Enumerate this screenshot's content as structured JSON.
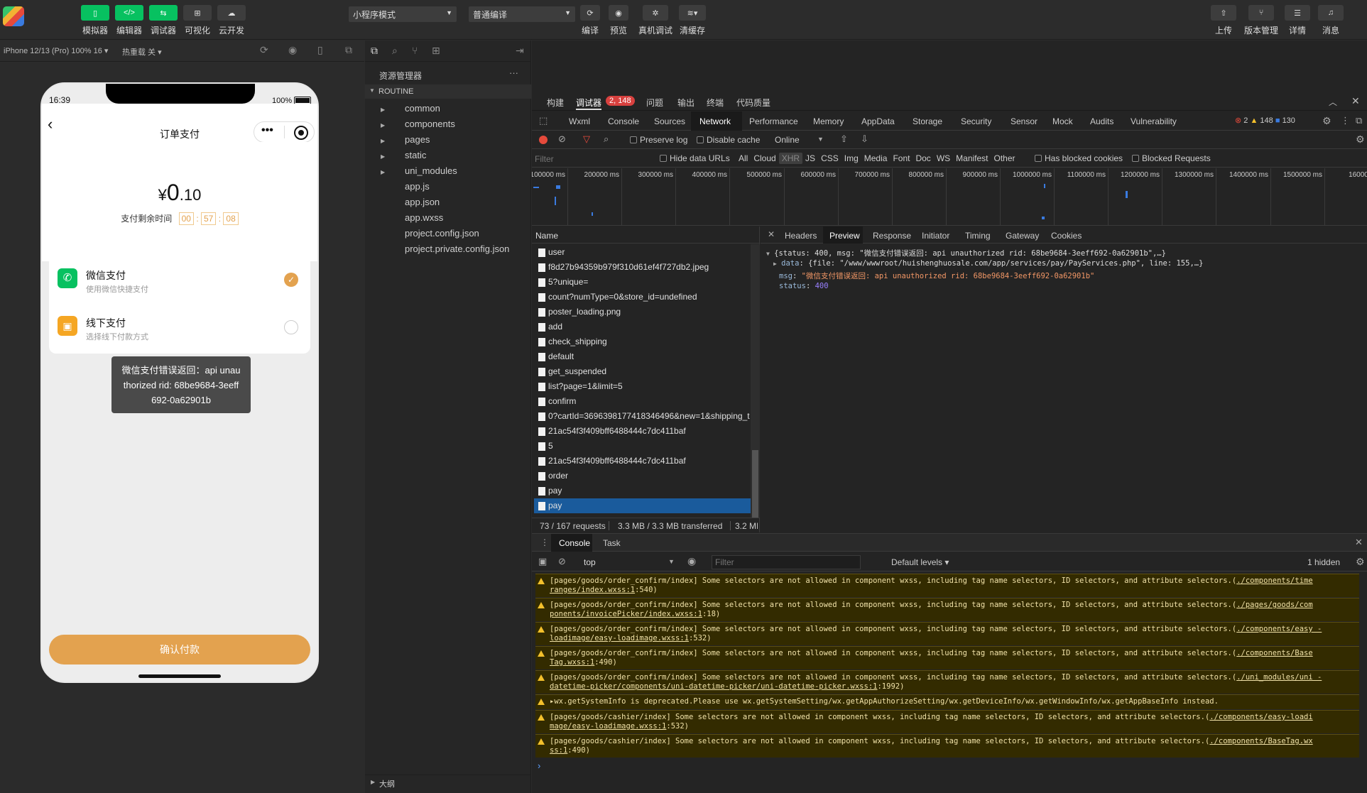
{
  "toolbar": {
    "left_buttons": [
      {
        "label": "模拟器",
        "icon": "phone-icon"
      },
      {
        "label": "编辑器",
        "icon": "code-icon"
      },
      {
        "label": "调试器",
        "icon": "debug-icon"
      },
      {
        "label": "可视化",
        "icon": "layout-icon"
      },
      {
        "label": "云开发",
        "icon": "cloud-icon"
      }
    ],
    "mode_select": "小程序模式",
    "compile_select": "普通编译",
    "mid_buttons": [
      {
        "label": "编译",
        "icon": "refresh-icon"
      },
      {
        "label": "预览",
        "icon": "eye-icon"
      },
      {
        "label": "真机调试",
        "icon": "bug-icon"
      },
      {
        "label": "清缓存",
        "icon": "layers-icon"
      }
    ],
    "right_buttons": [
      {
        "label": "上传",
        "icon": "upload-icon"
      },
      {
        "label": "版本管理",
        "icon": "branch-icon"
      },
      {
        "label": "详情",
        "icon": "menu-icon"
      },
      {
        "label": "消息",
        "icon": "bell-icon"
      }
    ]
  },
  "simulator": {
    "device": "iPhone 12/13 (Pro) 100% 16 ▾",
    "hot_reload": "热重载 关 ▾",
    "status_time": "16:39",
    "battery": "100%",
    "page_title": "订单支付",
    "price_symbol": "¥",
    "price_int": "0",
    "price_dec": ".10",
    "countdown_label": "支付剩余时间",
    "countdown": [
      "00",
      "57",
      "08"
    ],
    "countdown_sep": ":",
    "payments": [
      {
        "name": "微信支付",
        "desc": "使用微信快捷支付",
        "checked": true,
        "color": "#07c160"
      },
      {
        "name": "线下支付",
        "desc": "选择线下付款方式",
        "checked": false,
        "color": "#f5a623"
      }
    ],
    "toast": "微信支付错误返回：api unauthorized rid: 68be9684-3eeff692-0a62901b",
    "confirm_button": "确认付款",
    "accent": "#e3a24f"
  },
  "explorer": {
    "title": "资源管理器",
    "more": "···",
    "root": "ROUTINE",
    "items": [
      {
        "name": "common",
        "folder": true
      },
      {
        "name": "components",
        "folder": true
      },
      {
        "name": "pages",
        "folder": true
      },
      {
        "name": "static",
        "folder": true
      },
      {
        "name": "uni_modules",
        "folder": true
      },
      {
        "name": "app.js",
        "folder": false
      },
      {
        "name": "app.json",
        "folder": false
      },
      {
        "name": "app.wxss",
        "folder": false
      },
      {
        "name": "project.config.json",
        "folder": false
      },
      {
        "name": "project.private.config.json",
        "folder": false
      }
    ],
    "outline": "大纲"
  },
  "devtools": {
    "top_tabs": [
      "构建",
      "调试器",
      "问题",
      "输出",
      "终端",
      "代码质量"
    ],
    "debugger_badge": "2, 148",
    "panel_tabs": [
      "Wxml",
      "Console",
      "Sources",
      "Network",
      "Performance",
      "Memory",
      "AppData",
      "Storage",
      "Security",
      "Sensor",
      "Mock",
      "Audits",
      "Vulnerability"
    ],
    "errors": "2",
    "warnings": "148",
    "infos": "130",
    "preserve_log": "Preserve log",
    "disable_cache": "Disable cache",
    "throttle": "Online",
    "filter_placeholder": "Filter",
    "hide_data_urls": "Hide data URLs",
    "type_filters": [
      "All",
      "Cloud",
      "XHR",
      "JS",
      "CSS",
      "Img",
      "Media",
      "Font",
      "Doc",
      "WS",
      "Manifest",
      "Other"
    ],
    "has_blocked": "Has blocked cookies",
    "blocked_requests": "Blocked Requests",
    "timeline_ticks": [
      "100000 ms",
      "200000 ms",
      "300000 ms",
      "400000 ms",
      "500000 ms",
      "600000 ms",
      "700000 ms",
      "800000 ms",
      "900000 ms",
      "1000000 ms",
      "1100000 ms",
      "1200000 ms",
      "1300000 ms",
      "1400000 ms",
      "1500000 ms",
      "1600000"
    ],
    "name_header": "Name",
    "requests": [
      "user",
      "f8d27b94359b979f310d61ef4f727db2.jpeg",
      "5?unique=",
      "count?numType=0&store_id=undefined",
      "poster_loading.png",
      "add",
      "check_shipping",
      "default",
      "get_suspended",
      "list?page=1&limit=5",
      "confirm",
      "0?cartId=3696398177418346496&new=1&shipping_t",
      "21ac54f3f409bff6488444c7dc411baf",
      "5",
      "21ac54f3f409bff6488444c7dc411baf",
      "order",
      "pay",
      "pay"
    ],
    "summary": [
      "73 / 167 requests",
      "3.3 MB / 3.3 MB transferred",
      "3.2 MI"
    ],
    "detail_tabs": [
      "Headers",
      "Preview",
      "Response",
      "Initiator",
      "Timing",
      "Gateway",
      "Cookies"
    ],
    "preview": {
      "line1": "{status: 400, msg: \"微信支付错误返回: api unauthorized rid: 68be9684-3eeff692-0a62901b\",…}",
      "data_key": "data",
      "data_val": "{file: \"/www/wwwroot/huishenghuosale.com/app/services/pay/PayServices.php\", line: 155,…}",
      "msg_key": "msg",
      "msg_val": "\"微信支付错误返回: api unauthorized rid: 68be9684-3eeff692-0a62901b\"",
      "status_key": "status",
      "status_val": "400"
    },
    "console_tabs": [
      "Console",
      "Task"
    ],
    "context": "top",
    "console_filter": "Filter",
    "levels": "Default levels ▾",
    "hidden": "1 hidden",
    "messages": [
      {
        "text": "[pages/goods/order_confirm/index] Some selectors are not allowed in component wxss, including tag name selectors, ID selectors, and attribute selectors.(",
        "link": "./components/time ranges/index.wxss:1",
        "tail": ":540)"
      },
      {
        "text": "[pages/goods/order_confirm/index] Some selectors are not allowed in component wxss, including tag name selectors, ID selectors, and attribute selectors.(",
        "link": "./pages/goods/com ponents/invoicePicker/index.wxss:1",
        "tail": ":18)"
      },
      {
        "text": "[pages/goods/order_confirm/index] Some selectors are not allowed in component wxss, including tag name selectors, ID selectors, and attribute selectors.(",
        "link": "./components/easy -loadimage/easy-loadimage.wxss:1",
        "tail": ":532)"
      },
      {
        "text": "[pages/goods/order_confirm/index] Some selectors are not allowed in component wxss, including tag name selectors, ID selectors, and attribute selectors.(",
        "link": "./components/Base Tag.wxss:1",
        "tail": ":490)"
      },
      {
        "text": "[pages/goods/order_confirm/index] Some selectors are not allowed in component wxss, including tag name selectors, ID selectors, and attribute selectors.(",
        "link": "./uni_modules/uni -datetime-picker/components/uni-datetime-picker/uni-datetime-picker.wxss:1",
        "tail": ":1992)"
      },
      {
        "text": "▸wx.getSystemInfo is deprecated.Please use wx.getSystemSetting/wx.getAppAuthorizeSetting/wx.getDeviceInfo/wx.getWindowInfo/wx.getAppBaseInfo instead.",
        "link": "",
        "tail": ""
      },
      {
        "text": "[pages/goods/cashier/index] Some selectors are not allowed in component wxss, including tag name selectors, ID selectors, and attribute selectors.(",
        "link": "./components/easy-loadi mage/easy-loadimage.wxss:1",
        "tail": ":532)"
      },
      {
        "text": "[pages/goods/cashier/index] Some selectors are not allowed in component wxss, including tag name selectors, ID selectors, and attribute selectors.(",
        "link": "./components/BaseTag.wx ss:1",
        "tail": ":490)"
      }
    ],
    "prompt": "›"
  }
}
